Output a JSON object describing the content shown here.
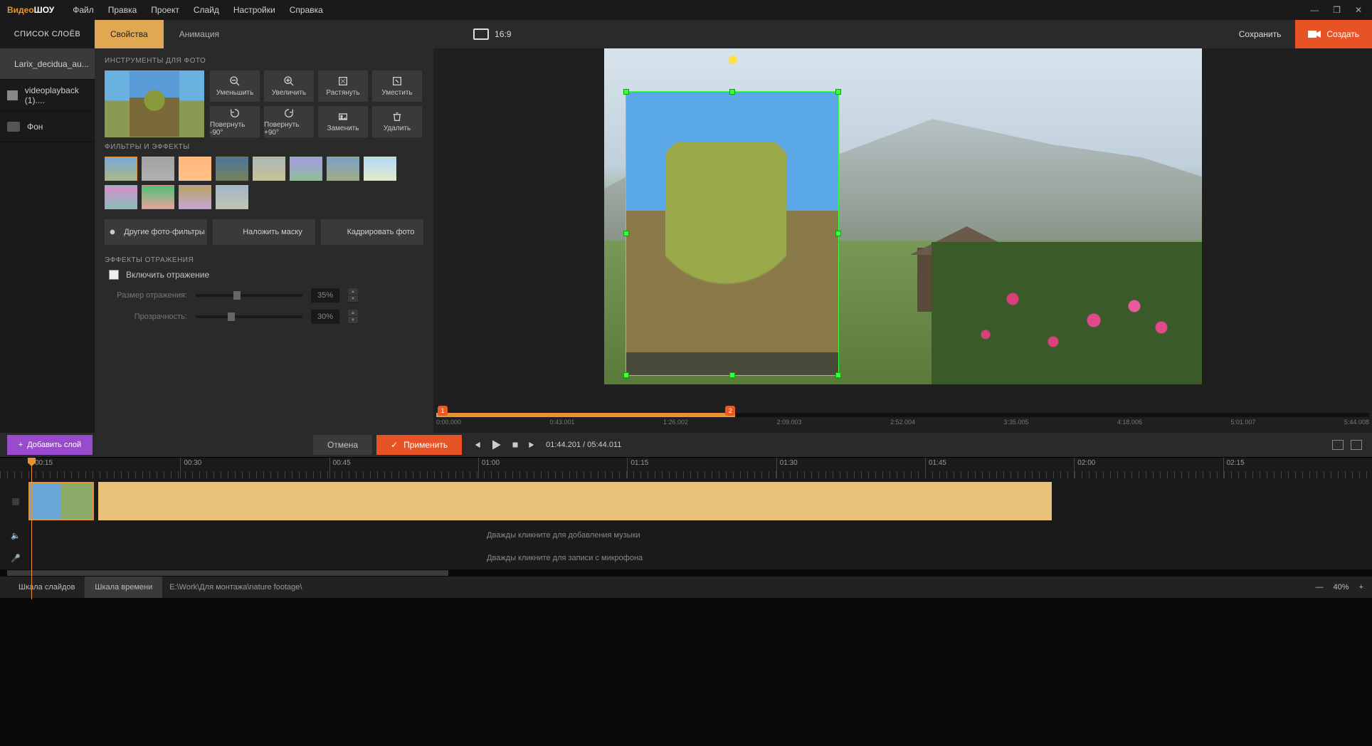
{
  "app": {
    "logo_a": "Видео",
    "logo_b": "ШОУ"
  },
  "menu": [
    "Файл",
    "Правка",
    "Проект",
    "Слайд",
    "Настройки",
    "Справка"
  ],
  "topbar": {
    "layers_title": "СПИСОК СЛОЁВ",
    "tabs": [
      "Свойства",
      "Анимация"
    ],
    "aspect": "16:9",
    "save": "Сохранить",
    "create": "Создать"
  },
  "layers": [
    {
      "name": "Larix_decidua_au..."
    },
    {
      "name": "videoplayback (1)...."
    },
    {
      "name": "Фон"
    }
  ],
  "props": {
    "tools_title": "ИНСТРУМЕНТЫ ДЛЯ ФОТО",
    "tools": [
      "Уменьшить",
      "Увеличить",
      "Растянуть",
      "Уместить",
      "Повернуть -90°",
      "Повернуть +90°",
      "Заменить",
      "Удалить"
    ],
    "filters_title": "ФИЛЬТРЫ И ЭФФЕКТЫ",
    "actions": [
      "Другие фото-фильтры",
      "Наложить маску",
      "Кадрировать фото"
    ],
    "reflect_title": "ЭФФЕКТЫ ОТРАЖЕНИЯ",
    "reflect_chk": "Включить отражение",
    "reflect_size_label": "Размер отражения:",
    "reflect_size_val": "35%",
    "reflect_opac_label": "Прозрачность:",
    "reflect_opac_val": "30%"
  },
  "preview": {
    "keys": [
      "1",
      "2"
    ],
    "ticks": [
      "0:00.000",
      "0:43.001",
      "1:26.002",
      "2:09.003",
      "2:52.004",
      "3:35.005",
      "4:18.006",
      "5:01.007",
      "5:44.008"
    ]
  },
  "actionbar": {
    "add_layer": "Добавить слой",
    "cancel": "Отмена",
    "apply": "Применить",
    "timecode": "01:44.201 / 05:44.011"
  },
  "timeline": {
    "marks": [
      "00:15",
      "00:30",
      "00:45",
      "01:00",
      "01:15",
      "01:30",
      "01:45",
      "02:00",
      "02:15"
    ],
    "music_hint": "Дважды кликните для добавления музыки",
    "mic_hint": "Дважды кликните для записи с микрофона"
  },
  "bottom": {
    "tabs": [
      "Шкала слайдов",
      "Шкала времени"
    ],
    "path": "E:\\Work\\Для монтажа\\nature footage\\",
    "zoom": "40%"
  }
}
